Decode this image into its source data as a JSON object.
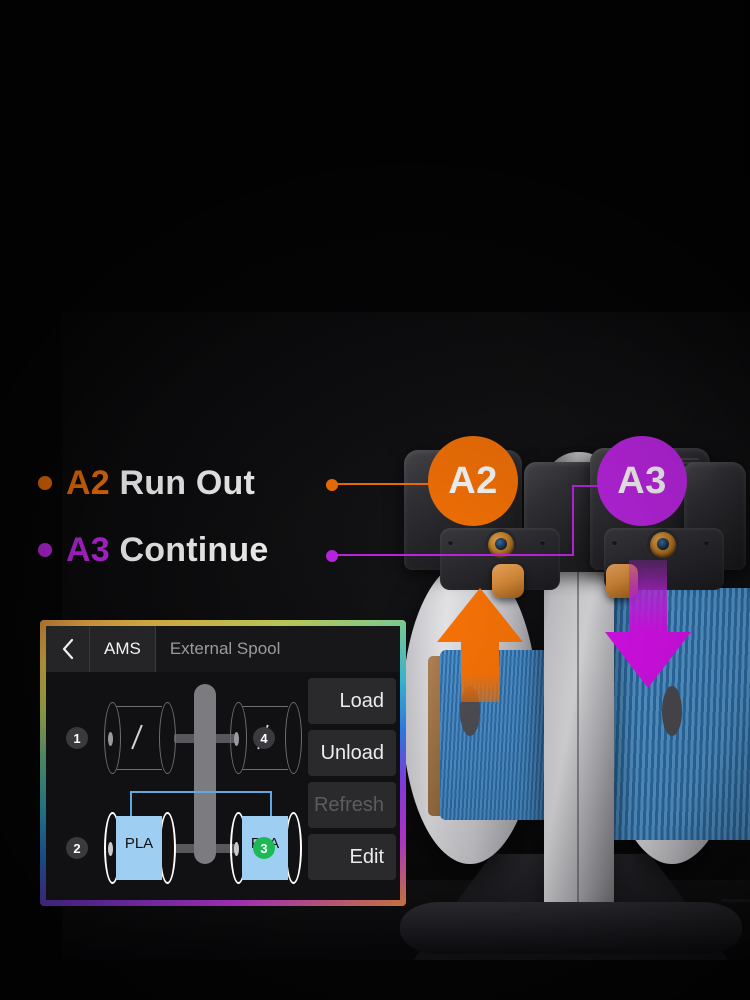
{
  "scene": {
    "title": "AMS filament run-out callout",
    "background_color": "#050505"
  },
  "callouts": [
    {
      "id": "a2",
      "code": "A2",
      "label": "Run Out",
      "color": "#f97306",
      "badge_text": "A2",
      "bullet_icon": "bullet-dot-icon",
      "arrow_icon": "arrow-up-icon",
      "arrow_direction": "up"
    },
    {
      "id": "a3",
      "code": "A3",
      "label": "Continue",
      "color": "#c026e8",
      "badge_text": "A3",
      "bullet_icon": "bullet-dot-icon",
      "arrow_icon": "arrow-down-icon",
      "arrow_direction": "down"
    }
  ],
  "ams_panel": {
    "border_gradient": "rainbow",
    "back_icon": "chevron-left-icon",
    "tabs": [
      {
        "label": "AMS",
        "active": true
      },
      {
        "label": "External Spool",
        "active": false
      }
    ],
    "buttons": [
      {
        "label": "Load",
        "disabled": false
      },
      {
        "label": "Unload",
        "disabled": false
      },
      {
        "label": "Refresh",
        "disabled": true
      },
      {
        "label": "Edit",
        "disabled": false
      }
    ],
    "slots": [
      {
        "number": "1",
        "material": "/",
        "state": "empty",
        "badge_active": false,
        "position": "top-left"
      },
      {
        "number": "4",
        "material": "/",
        "state": "empty",
        "badge_active": false,
        "position": "top-right"
      },
      {
        "number": "2",
        "material": "PLA",
        "state": "filled",
        "badge_active": false,
        "position": "bottom-left"
      },
      {
        "number": "3",
        "material": "PLA",
        "state": "filled",
        "badge_active": true,
        "position": "bottom-right"
      }
    ],
    "sensor": {
      "icon": "filament-sensor-icon",
      "status_color": "#1db954"
    },
    "filament_path_color": "#5fa8e0",
    "filament_color": "#9ecff2"
  },
  "hardware": {
    "name": "ams-unit",
    "spools": [
      {
        "side": "left",
        "filament_color": "#3b7ab4",
        "core": "cardboard",
        "level": "low"
      },
      {
        "side": "right",
        "filament_color": "#3e83bf",
        "core": "plastic",
        "level": "full"
      }
    ]
  }
}
